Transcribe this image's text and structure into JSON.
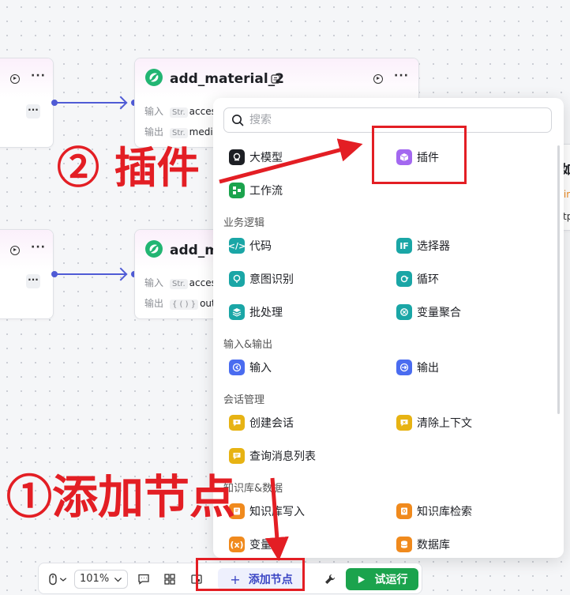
{
  "nodes": {
    "node_a": {
      "title": "add_material_2",
      "input_label": "输入",
      "input_type": "Str.",
      "input_value": "access",
      "output_label": "输出",
      "output_type": "Str.",
      "output_value": "media"
    },
    "node_b": {
      "title": "add_ma",
      "input_label": "输入",
      "input_type": "Str.",
      "input_value": "access",
      "output_label": "输出",
      "output_type": "{ ( ) }",
      "output_value": "output"
    },
    "partial_right": {
      "title": "如",
      "line1": "rin",
      "line2": "tp"
    },
    "more_glyph": "···"
  },
  "panel": {
    "search_placeholder": "搜索",
    "top_items": [
      {
        "label": "大模型",
        "icon": "llm-icon"
      },
      {
        "label": "插件",
        "icon": "plugin-icon"
      },
      {
        "label": "工作流",
        "icon": "workflow-icon"
      }
    ],
    "sections": [
      {
        "title": "业务逻辑",
        "items": [
          {
            "label": "代码",
            "icon": "code-icon"
          },
          {
            "label": "选择器",
            "icon": "selector-icon"
          },
          {
            "label": "意图识别",
            "icon": "intent-icon"
          },
          {
            "label": "循环",
            "icon": "loop-icon"
          },
          {
            "label": "批处理",
            "icon": "batch-icon"
          },
          {
            "label": "变量聚合",
            "icon": "variable-merge-icon"
          }
        ]
      },
      {
        "title": "输入&输出",
        "items": [
          {
            "label": "输入",
            "icon": "input-icon"
          },
          {
            "label": "输出",
            "icon": "output-icon"
          }
        ]
      },
      {
        "title": "会话管理",
        "items": [
          {
            "label": "创建会话",
            "icon": "create-conversation-icon"
          },
          {
            "label": "清除上下文",
            "icon": "clear-context-icon"
          },
          {
            "label": "查询消息列表",
            "icon": "message-list-icon"
          }
        ]
      },
      {
        "title": "知识库&数据",
        "items": [
          {
            "label": "知识库写入",
            "icon": "kb-write-icon"
          },
          {
            "label": "知识库检索",
            "icon": "kb-search-icon"
          },
          {
            "label": "变量",
            "icon": "variable-icon"
          },
          {
            "label": "数据库",
            "icon": "database-icon"
          }
        ]
      }
    ]
  },
  "toolbar": {
    "zoom": "101%",
    "add_node_label": "添加节点",
    "add_node_glyph": "+",
    "run_label": "试运行"
  },
  "annotations": {
    "step2": "② 插件",
    "step1": "①添加节点"
  },
  "colors": {
    "accent": "#4f5bd5",
    "run_green": "#1ba34d",
    "annotation_red": "#e31e24"
  }
}
